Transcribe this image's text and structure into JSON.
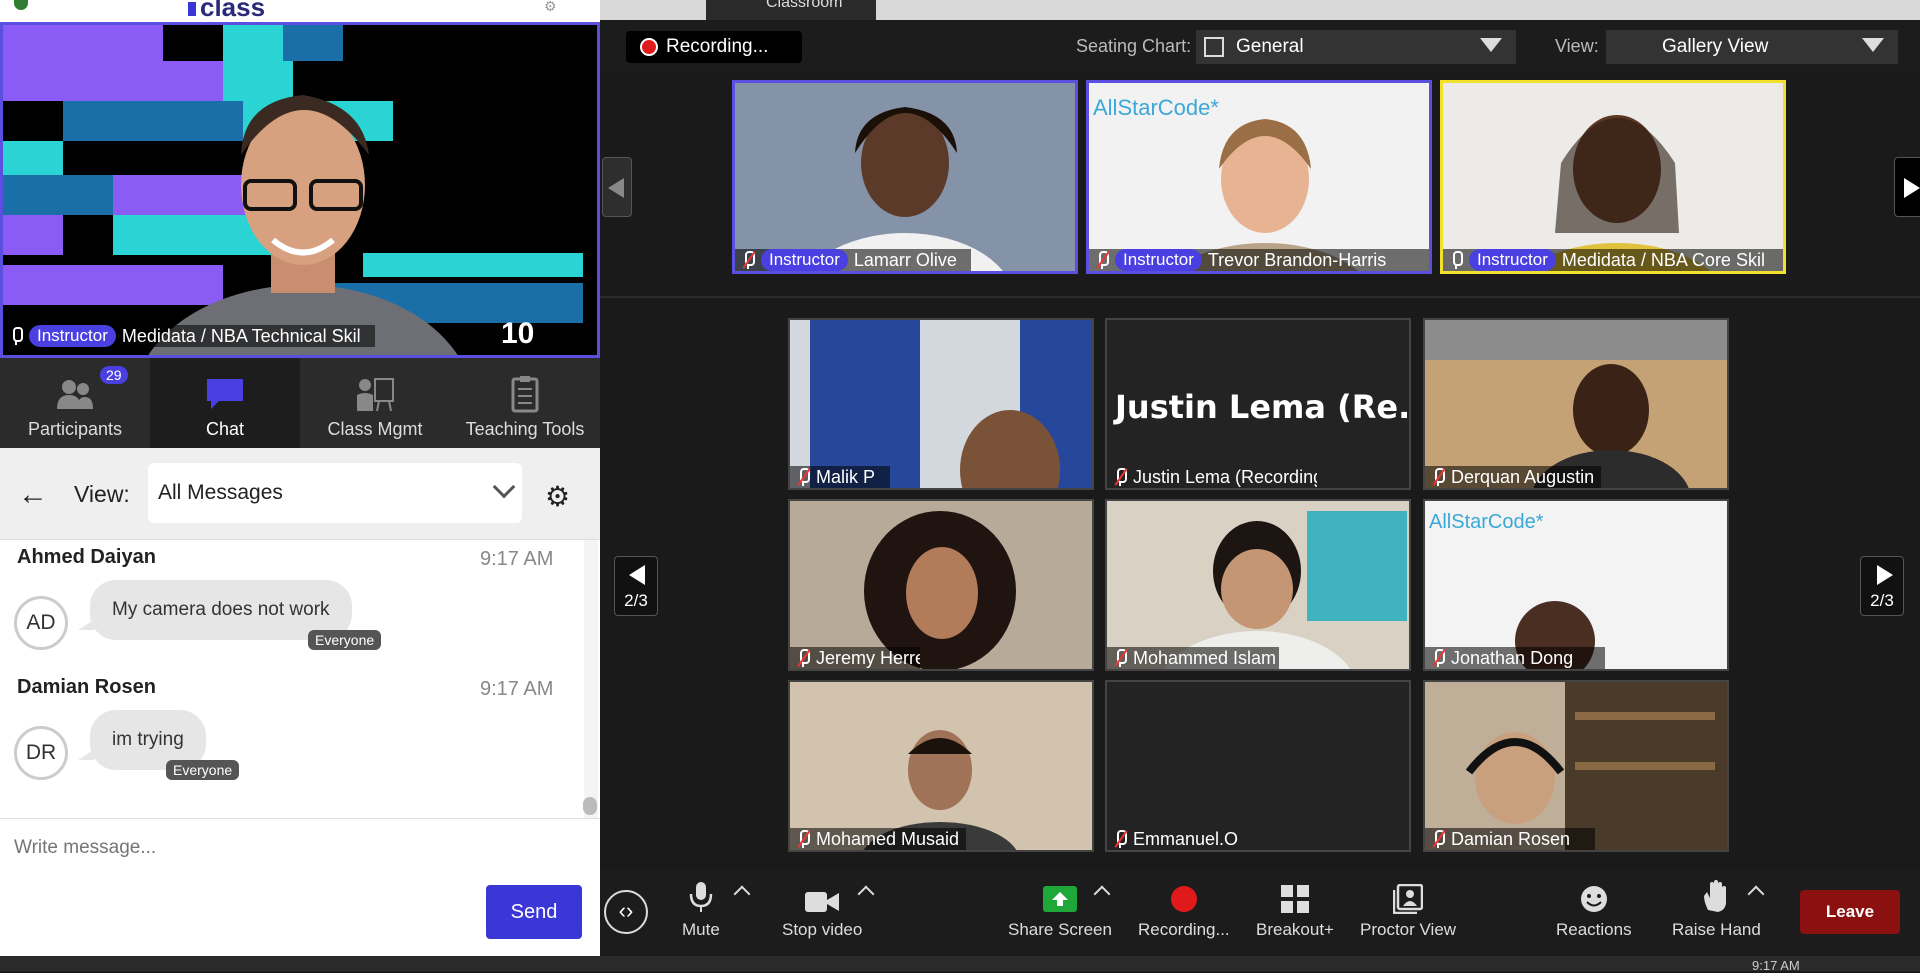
{
  "app": {
    "logo_text": "class",
    "classroom_tab": "Classroom"
  },
  "self_view": {
    "role": "Instructor",
    "name": "Medidata / NBA Technical Skil",
    "watermark": "10"
  },
  "tabs": [
    {
      "label": "Participants",
      "badge": "29",
      "icon": "participants-icon"
    },
    {
      "label": "Chat",
      "icon": "chat-icon"
    },
    {
      "label": "Class Mgmt",
      "icon": "class-mgmt-icon"
    },
    {
      "label": "Teaching Tools",
      "icon": "teaching-tools-icon"
    }
  ],
  "chat": {
    "view_label": "View:",
    "view_value": "All Messages",
    "messages": [
      {
        "sender": "Ahmed Daiyan",
        "initials": "AD",
        "time": "9:17 AM",
        "text": "My camera does not work",
        "to": "Everyone"
      },
      {
        "sender": "Damian Rosen",
        "initials": "DR",
        "time": "9:17 AM",
        "text": "im trying",
        "to": "Everyone"
      }
    ],
    "compose_placeholder": "Write message...",
    "send_label": "Send"
  },
  "top_bar": {
    "recording": "Recording...",
    "seating_label": "Seating Chart:",
    "seating_value": "General",
    "view_label": "View:",
    "view_value": "Gallery View"
  },
  "instructors": [
    {
      "role": "Instructor",
      "name": "Lamarr Olive"
    },
    {
      "role": "Instructor",
      "name": "Trevor Brandon-Harris"
    },
    {
      "role": "Instructor",
      "name": "Medidata / NBA Core Skil"
    }
  ],
  "brand_overlay": "AllStarCode*",
  "students": [
    {
      "name": "Malik P"
    },
    {
      "name": "Justin Lema (Recording)",
      "big": "Justin Lema (Re..."
    },
    {
      "name": "Derquan Augustin"
    },
    {
      "name": "Jeremy Herrera"
    },
    {
      "name": "Mohammed Islam"
    },
    {
      "name": "Jonathan Dong"
    },
    {
      "name": "Mohamed Musaid"
    },
    {
      "name": "Emmanuel.O"
    },
    {
      "name": "Damian Rosen"
    }
  ],
  "pager": {
    "left": "2/3",
    "right": "2/3"
  },
  "bottom_bar": {
    "mute": "Mute",
    "stop_video": "Stop video",
    "share_screen": "Share Screen",
    "recording": "Recording...",
    "breakout": "Breakout+",
    "proctor": "Proctor View",
    "reactions": "Reactions",
    "raise_hand": "Raise Hand",
    "leave": "Leave"
  },
  "taskbar": {
    "time": "9:17 AM"
  },
  "colors": {
    "accent": "#4a3fe0",
    "active_speaker": "#f2e12a",
    "leave": "#8b1010",
    "recording": "#e01a1a",
    "share": "#1fa83a"
  }
}
